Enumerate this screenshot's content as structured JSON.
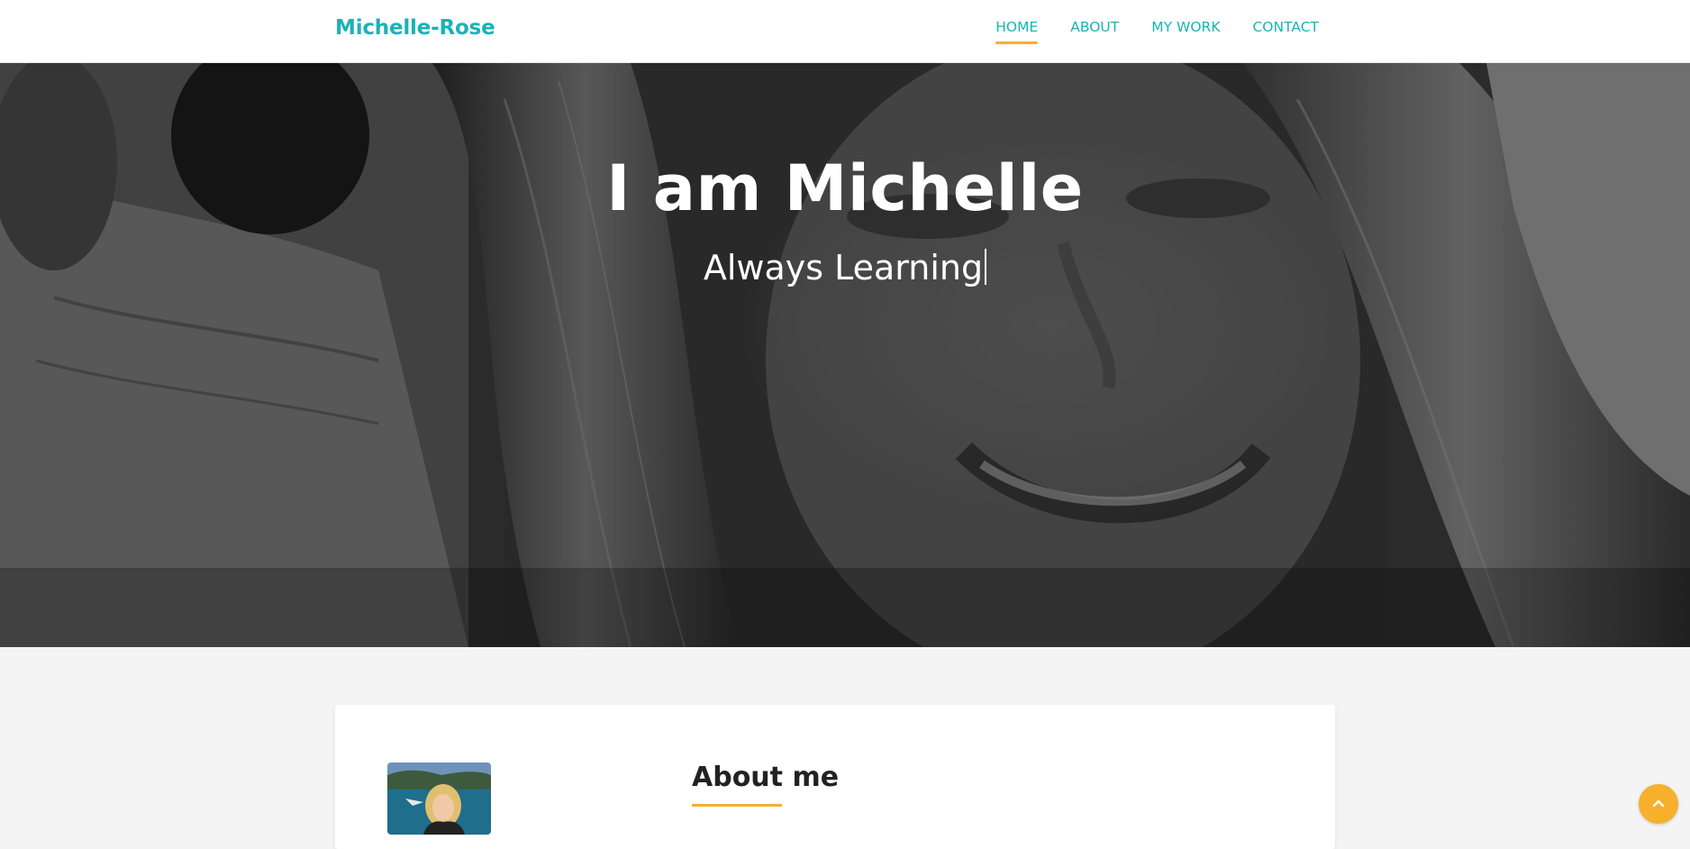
{
  "navbar": {
    "brand": "Michelle-Rose",
    "links": [
      {
        "label": "HOME",
        "active": true
      },
      {
        "label": "ABOUT",
        "active": false
      },
      {
        "label": "MY WORK",
        "active": false
      },
      {
        "label": "CONTACT",
        "active": false
      }
    ]
  },
  "hero": {
    "title": "I am Michelle",
    "subtitle": "Always Learning"
  },
  "about": {
    "heading": "About me"
  },
  "colors": {
    "accent": "#1ab3b5",
    "highlight": "#f6b02b"
  },
  "icons": {
    "back_to_top": "chevron-up-icon"
  }
}
